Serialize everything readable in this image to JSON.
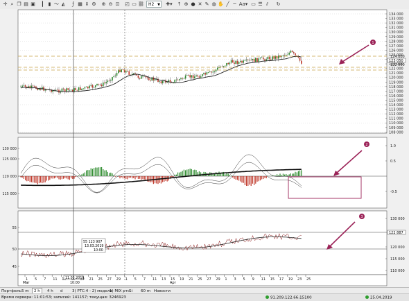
{
  "toolbar": {
    "timeframe": "H2",
    "aa_label": "Aa"
  },
  "chart": {
    "price_axis": [
      "134 000",
      "133 000",
      "132 000",
      "131 000",
      "130 000",
      "129 000",
      "128 000",
      "127 000",
      "126 000",
      "125 000",
      "124 000",
      "123 000",
      "122 000",
      "121 000",
      "120 000",
      "119 000",
      "118 000",
      "117 000",
      "116 000",
      "115 000",
      "114 000",
      "113 000",
      "112 000",
      "111 000",
      "110 000",
      "109 000",
      "108 000"
    ],
    "price_labels_right": {
      "current": "123 050",
      "upper": "124 000",
      "lower": "122 000"
    },
    "osc_left_axis": [
      "130 000",
      "125 000",
      "120 000",
      "115 000"
    ],
    "osc_right_axis": [
      "1.0",
      "0.5",
      "",
      "-0.5"
    ],
    "rsi_left_axis": [
      "55",
      "50",
      "45"
    ],
    "rsi_right_axis": [
      "130 000",
      "125 000",
      "120 000",
      "115 000",
      "110 000"
    ],
    "rsi_right_value": "122 887",
    "crosshair": {
      "x_label": "11.03.2019",
      "x_label2": "10:00",
      "tooltip_line1": "55  123 907",
      "tooltip_line2": "13.03.2019",
      "tooltip_line3": "10:00"
    },
    "date_axis": [
      "1",
      "5",
      "7",
      "11",
      "13",
      "15",
      "19",
      "21",
      "25",
      "27",
      "29",
      "1",
      "5",
      "7",
      "11",
      "13",
      "15",
      "19",
      "21",
      "25",
      "27",
      "29",
      "1",
      "3",
      "5",
      "9",
      "11",
      "15",
      "17",
      "19",
      "23",
      "25"
    ],
    "month_labels": {
      "mar": "Mar",
      "apr": "Apr"
    },
    "annotations": [
      "1",
      "2",
      "3"
    ],
    "accent_colors": {
      "annotation": "#9b2257",
      "up": "#2e8b2e",
      "down": "#c0392b",
      "level_line": "#c7a44a"
    }
  },
  "tabs": [
    {
      "label": "Портфель"
    },
    {
      "label": "5 m"
    },
    {
      "label": "2 h",
      "active": true
    },
    {
      "label": "4 h"
    },
    {
      "label": "d"
    },
    {
      "label": "3( РТС:4 - 2) модели"
    },
    {
      "label": "1) MIX ртс"
    },
    {
      "label": "Si"
    },
    {
      "label": "60 m"
    },
    {
      "label": "Новости"
    }
  ],
  "status": {
    "server_time": "Время сервера: 11:01:53; записей: 141157; текущая: 3246923",
    "connection": "91.209.122.66:15100",
    "date": "25.04.2019"
  }
}
